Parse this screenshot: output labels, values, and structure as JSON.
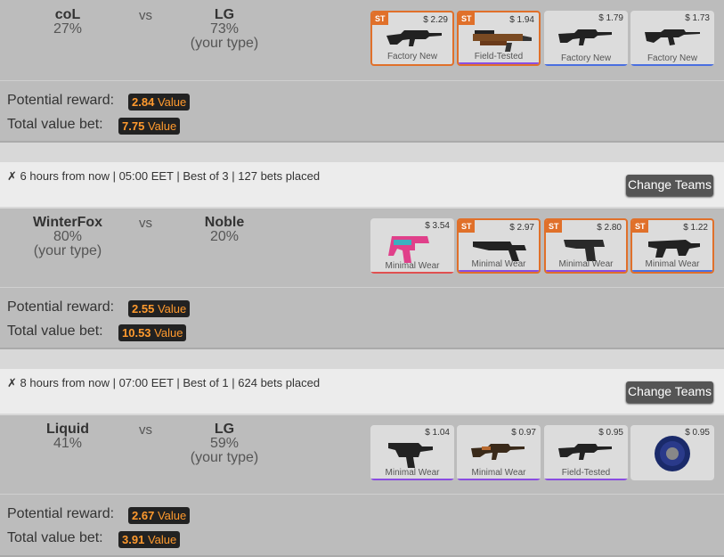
{
  "colors": {
    "st": "#e0702a",
    "value_text": "#ff9a2e",
    "value_bg": "#222222",
    "purple": "#8a4de0",
    "blue": "#4a6fe0",
    "red": "#e05050"
  },
  "matches": [
    {
      "team1": {
        "name": "coL",
        "percent": "27%",
        "note": ""
      },
      "team2": {
        "name": "LG",
        "percent": "73%",
        "note": "(your type)"
      },
      "vs": "vs",
      "items": [
        {
          "price": "$ 2.29",
          "wear": "Factory New",
          "st": "ST",
          "icon": "rifle-icon",
          "rarity": "blue"
        },
        {
          "price": "$ 1.94",
          "wear": "Field-Tested",
          "st": "ST",
          "icon": "smg-icon",
          "rarity": "purple"
        },
        {
          "price": "$ 1.79",
          "wear": "Factory New",
          "st": "",
          "icon": "rifle-icon",
          "rarity": "blue"
        },
        {
          "price": "$ 1.73",
          "wear": "Factory New",
          "st": "",
          "icon": "rifle-icon",
          "rarity": "blue"
        }
      ],
      "reward_label": "Potential reward:",
      "reward_value": "2.84",
      "reward_unit": "Value",
      "bet_label": "Total value bet:",
      "bet_value": "7.75",
      "bet_unit": "Value"
    },
    {
      "info": "6 hours from now | 05:00 EET | Best of 3 | 127 bets placed",
      "change_teams": "Change Teams",
      "team1": {
        "name": "WinterFox",
        "percent": "80%",
        "note": "(your type)"
      },
      "team2": {
        "name": "Noble",
        "percent": "20%",
        "note": ""
      },
      "vs": "vs",
      "items": [
        {
          "price": "$ 3.54",
          "wear": "Minimal Wear",
          "st": "",
          "icon": "smg-icon",
          "rarity": "red"
        },
        {
          "price": "$ 2.97",
          "wear": "Minimal Wear",
          "st": "ST",
          "icon": "pistol-icon",
          "rarity": "purple"
        },
        {
          "price": "$ 2.80",
          "wear": "Minimal Wear",
          "st": "ST",
          "icon": "pistol-icon",
          "rarity": "purple"
        },
        {
          "price": "$ 1.22",
          "wear": "Minimal Wear",
          "st": "ST",
          "icon": "smg-icon",
          "rarity": "blue"
        }
      ],
      "reward_label": "Potential reward:",
      "reward_value": "2.55",
      "reward_unit": "Value",
      "bet_label": "Total value bet:",
      "bet_value": "10.53",
      "bet_unit": "Value"
    },
    {
      "info": "8 hours from now | 07:00 EET | Best of 1 | 624 bets placed",
      "change_teams": "Change Teams",
      "team1": {
        "name": "Liquid",
        "percent": "41%",
        "note": ""
      },
      "team2": {
        "name": "LG",
        "percent": "59%",
        "note": "(your type)"
      },
      "vs": "vs",
      "items": [
        {
          "price": "$ 1.04",
          "wear": "Minimal Wear",
          "st": "",
          "icon": "smg-icon",
          "rarity": "purple"
        },
        {
          "price": "$ 0.97",
          "wear": "Minimal Wear",
          "st": "",
          "icon": "rifle-icon",
          "rarity": "purple"
        },
        {
          "price": "$ 0.95",
          "wear": "Field-Tested",
          "st": "",
          "icon": "rifle-icon",
          "rarity": "purple"
        },
        {
          "price": "$ 0.95",
          "wear": "",
          "st": "",
          "icon": "sticker-icon",
          "rarity": "none"
        }
      ],
      "reward_label": "Potential reward:",
      "reward_value": "2.67",
      "reward_unit": "Value",
      "bet_label": "Total value bet:",
      "bet_value": "3.91",
      "bet_unit": "Value"
    }
  ]
}
